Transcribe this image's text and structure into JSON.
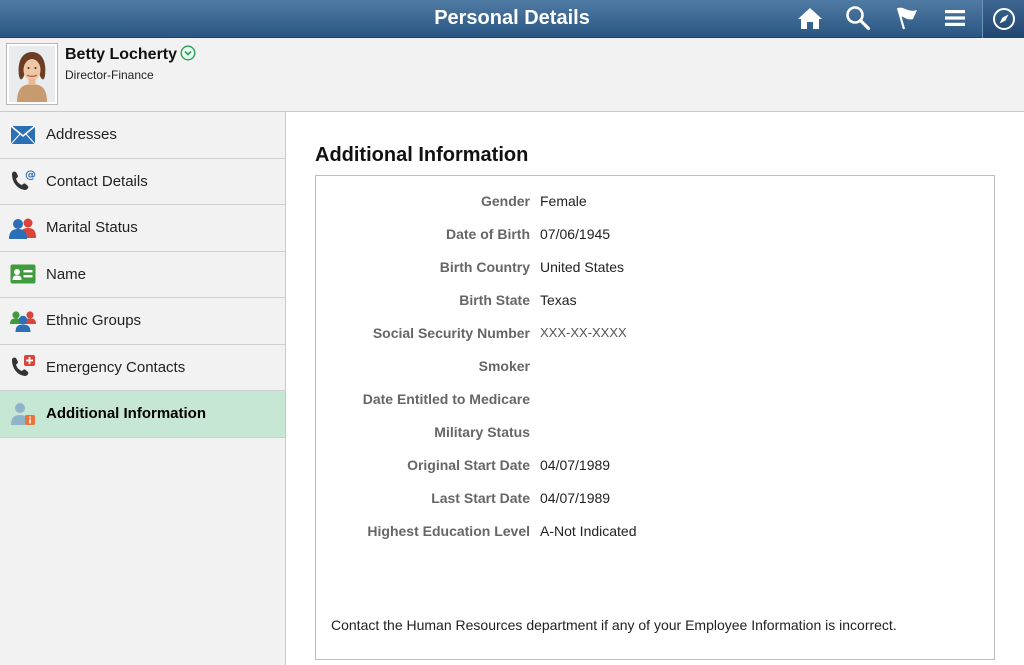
{
  "header": {
    "title": "Personal Details",
    "colors": {
      "bar_top": "#4f7aa3",
      "bar_bottom": "#2a5683"
    }
  },
  "person": {
    "name": "Betty Locherty",
    "title": "Director-Finance"
  },
  "sidebar": {
    "items": [
      {
        "label": "Addresses",
        "icon": "envelope-icon"
      },
      {
        "label": "Contact Details",
        "icon": "phone-at-icon"
      },
      {
        "label": "Marital Status",
        "icon": "couple-icon"
      },
      {
        "label": "Name",
        "icon": "id-card-icon"
      },
      {
        "label": "Ethnic Groups",
        "icon": "group-icon"
      },
      {
        "label": "Emergency Contacts",
        "icon": "phone-emergency-icon"
      },
      {
        "label": "Additional Information",
        "icon": "person-info-icon",
        "active": true
      }
    ],
    "active_color": "#c6e7d3"
  },
  "main": {
    "section_title": "Additional Information",
    "fields": [
      {
        "label": "Gender",
        "value": "Female"
      },
      {
        "label": "Date of Birth",
        "value": "07/06/1945"
      },
      {
        "label": "Birth Country",
        "value": "United States"
      },
      {
        "label": "Birth State",
        "value": "Texas"
      },
      {
        "label": "Social Security Number",
        "value": "XXX-XX-XXXX"
      },
      {
        "label": "Smoker",
        "value": ""
      },
      {
        "label": "Date Entitled to Medicare",
        "value": ""
      },
      {
        "label": "Military Status",
        "value": ""
      },
      {
        "label": "Original Start Date",
        "value": "04/07/1989"
      },
      {
        "label": "Last Start Date",
        "value": "04/07/1989"
      },
      {
        "label": "Highest Education Level",
        "value": "A-Not Indicated"
      }
    ],
    "footnote": "Contact the Human Resources department if any of your Employee Information is incorrect."
  }
}
